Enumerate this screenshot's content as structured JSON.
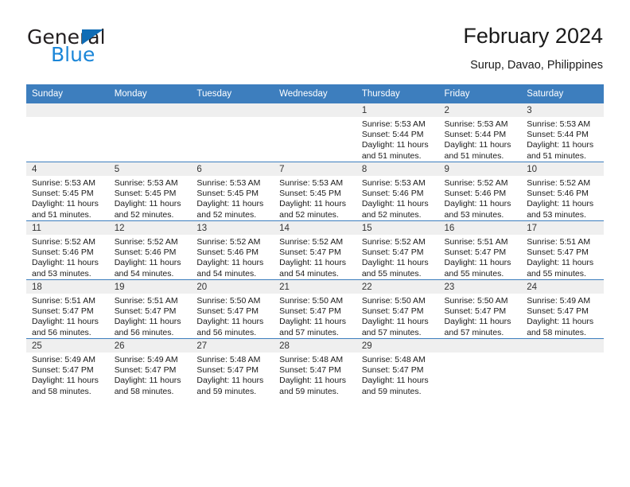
{
  "brand": {
    "name_top": "General",
    "name_bottom": "Blue",
    "color_dark": "#231f20",
    "color_blue": "#1b86d8",
    "triangle_color": "#0f6cb5"
  },
  "header": {
    "title": "February 2024",
    "location": "Surup, Davao, Philippines"
  },
  "theme": {
    "header_bg": "#3d7ebe",
    "daynum_bg": "#efefef",
    "text": "#1a1a1a"
  },
  "calendar": {
    "weekday_headers": [
      "Sunday",
      "Monday",
      "Tuesday",
      "Wednesday",
      "Thursday",
      "Friday",
      "Saturday"
    ],
    "weeks": [
      [
        {
          "day": "",
          "lines": []
        },
        {
          "day": "",
          "lines": []
        },
        {
          "day": "",
          "lines": []
        },
        {
          "day": "",
          "lines": []
        },
        {
          "day": "1",
          "lines": [
            "Sunrise: 5:53 AM",
            "Sunset: 5:44 PM",
            "Daylight: 11 hours",
            "and 51 minutes."
          ]
        },
        {
          "day": "2",
          "lines": [
            "Sunrise: 5:53 AM",
            "Sunset: 5:44 PM",
            "Daylight: 11 hours",
            "and 51 minutes."
          ]
        },
        {
          "day": "3",
          "lines": [
            "Sunrise: 5:53 AM",
            "Sunset: 5:44 PM",
            "Daylight: 11 hours",
            "and 51 minutes."
          ]
        }
      ],
      [
        {
          "day": "4",
          "lines": [
            "Sunrise: 5:53 AM",
            "Sunset: 5:45 PM",
            "Daylight: 11 hours",
            "and 51 minutes."
          ]
        },
        {
          "day": "5",
          "lines": [
            "Sunrise: 5:53 AM",
            "Sunset: 5:45 PM",
            "Daylight: 11 hours",
            "and 52 minutes."
          ]
        },
        {
          "day": "6",
          "lines": [
            "Sunrise: 5:53 AM",
            "Sunset: 5:45 PM",
            "Daylight: 11 hours",
            "and 52 minutes."
          ]
        },
        {
          "day": "7",
          "lines": [
            "Sunrise: 5:53 AM",
            "Sunset: 5:45 PM",
            "Daylight: 11 hours",
            "and 52 minutes."
          ]
        },
        {
          "day": "8",
          "lines": [
            "Sunrise: 5:53 AM",
            "Sunset: 5:46 PM",
            "Daylight: 11 hours",
            "and 52 minutes."
          ]
        },
        {
          "day": "9",
          "lines": [
            "Sunrise: 5:52 AM",
            "Sunset: 5:46 PM",
            "Daylight: 11 hours",
            "and 53 minutes."
          ]
        },
        {
          "day": "10",
          "lines": [
            "Sunrise: 5:52 AM",
            "Sunset: 5:46 PM",
            "Daylight: 11 hours",
            "and 53 minutes."
          ]
        }
      ],
      [
        {
          "day": "11",
          "lines": [
            "Sunrise: 5:52 AM",
            "Sunset: 5:46 PM",
            "Daylight: 11 hours",
            "and 53 minutes."
          ]
        },
        {
          "day": "12",
          "lines": [
            "Sunrise: 5:52 AM",
            "Sunset: 5:46 PM",
            "Daylight: 11 hours",
            "and 54 minutes."
          ]
        },
        {
          "day": "13",
          "lines": [
            "Sunrise: 5:52 AM",
            "Sunset: 5:46 PM",
            "Daylight: 11 hours",
            "and 54 minutes."
          ]
        },
        {
          "day": "14",
          "lines": [
            "Sunrise: 5:52 AM",
            "Sunset: 5:47 PM",
            "Daylight: 11 hours",
            "and 54 minutes."
          ]
        },
        {
          "day": "15",
          "lines": [
            "Sunrise: 5:52 AM",
            "Sunset: 5:47 PM",
            "Daylight: 11 hours",
            "and 55 minutes."
          ]
        },
        {
          "day": "16",
          "lines": [
            "Sunrise: 5:51 AM",
            "Sunset: 5:47 PM",
            "Daylight: 11 hours",
            "and 55 minutes."
          ]
        },
        {
          "day": "17",
          "lines": [
            "Sunrise: 5:51 AM",
            "Sunset: 5:47 PM",
            "Daylight: 11 hours",
            "and 55 minutes."
          ]
        }
      ],
      [
        {
          "day": "18",
          "lines": [
            "Sunrise: 5:51 AM",
            "Sunset: 5:47 PM",
            "Daylight: 11 hours",
            "and 56 minutes."
          ]
        },
        {
          "day": "19",
          "lines": [
            "Sunrise: 5:51 AM",
            "Sunset: 5:47 PM",
            "Daylight: 11 hours",
            "and 56 minutes."
          ]
        },
        {
          "day": "20",
          "lines": [
            "Sunrise: 5:50 AM",
            "Sunset: 5:47 PM",
            "Daylight: 11 hours",
            "and 56 minutes."
          ]
        },
        {
          "day": "21",
          "lines": [
            "Sunrise: 5:50 AM",
            "Sunset: 5:47 PM",
            "Daylight: 11 hours",
            "and 57 minutes."
          ]
        },
        {
          "day": "22",
          "lines": [
            "Sunrise: 5:50 AM",
            "Sunset: 5:47 PM",
            "Daylight: 11 hours",
            "and 57 minutes."
          ]
        },
        {
          "day": "23",
          "lines": [
            "Sunrise: 5:50 AM",
            "Sunset: 5:47 PM",
            "Daylight: 11 hours",
            "and 57 minutes."
          ]
        },
        {
          "day": "24",
          "lines": [
            "Sunrise: 5:49 AM",
            "Sunset: 5:47 PM",
            "Daylight: 11 hours",
            "and 58 minutes."
          ]
        }
      ],
      [
        {
          "day": "25",
          "lines": [
            "Sunrise: 5:49 AM",
            "Sunset: 5:47 PM",
            "Daylight: 11 hours",
            "and 58 minutes."
          ]
        },
        {
          "day": "26",
          "lines": [
            "Sunrise: 5:49 AM",
            "Sunset: 5:47 PM",
            "Daylight: 11 hours",
            "and 58 minutes."
          ]
        },
        {
          "day": "27",
          "lines": [
            "Sunrise: 5:48 AM",
            "Sunset: 5:47 PM",
            "Daylight: 11 hours",
            "and 59 minutes."
          ]
        },
        {
          "day": "28",
          "lines": [
            "Sunrise: 5:48 AM",
            "Sunset: 5:47 PM",
            "Daylight: 11 hours",
            "and 59 minutes."
          ]
        },
        {
          "day": "29",
          "lines": [
            "Sunrise: 5:48 AM",
            "Sunset: 5:47 PM",
            "Daylight: 11 hours",
            "and 59 minutes."
          ]
        },
        {
          "day": "",
          "lines": []
        },
        {
          "day": "",
          "lines": []
        }
      ]
    ]
  }
}
